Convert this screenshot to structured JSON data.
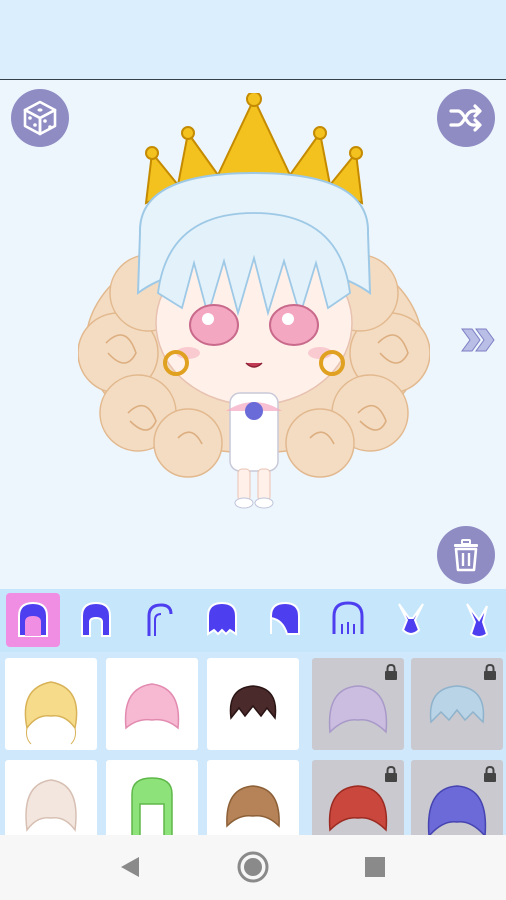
{
  "app": {
    "accent": "#8f8cc4",
    "tab_active_color": "#f08ee3",
    "tabbar_color": "#c6e6fb"
  },
  "top_actions": {
    "random_icon": "dice-icon",
    "shuffle_icon": "shuffle-icon",
    "next_icon": "double-chevron-right-icon",
    "delete_icon": "trash-icon"
  },
  "tabs": [
    {
      "name": "hair-back-full",
      "active": true
    },
    {
      "name": "hair-back-half",
      "active": false
    },
    {
      "name": "hair-side",
      "active": false
    },
    {
      "name": "bangs-full",
      "active": false
    },
    {
      "name": "bangs-side",
      "active": false
    },
    {
      "name": "bangs-outline",
      "active": false
    },
    {
      "name": "ears-bunny",
      "active": false
    },
    {
      "name": "ears-bunny-alt",
      "active": false
    }
  ],
  "hair_options": [
    {
      "color": "#f6dc8a",
      "locked": false
    },
    {
      "color": "#f7b8d2",
      "locked": false
    },
    {
      "color": "#4a2a2a",
      "locked": false
    },
    {
      "color": "#cbbde0",
      "locked": true
    },
    {
      "color": "#b9d4e6",
      "locked": true
    },
    {
      "color": "#f3e6df",
      "locked": false
    },
    {
      "color": "#8ee27a",
      "locked": false
    },
    {
      "color": "#b58357",
      "locked": false
    },
    {
      "color": "#c9473c",
      "locked": true
    },
    {
      "color": "#6c6ad8",
      "locked": true
    }
  ],
  "navbar": {
    "back_icon": "back-triangle-icon",
    "home_icon": "home-circle-icon",
    "recents_icon": "recents-square-icon"
  }
}
